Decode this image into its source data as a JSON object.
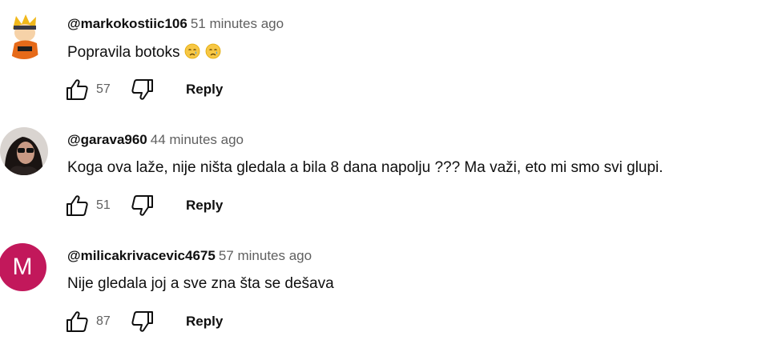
{
  "comments": [
    {
      "handle": "@markokostiic106",
      "time": "51 minutes ago",
      "text": "Popravila botoks",
      "emojis": [
        "crying-face",
        "crying-face"
      ],
      "likes": "57",
      "reply_label": "Reply"
    },
    {
      "handle": "@garava960",
      "time": "44 minutes ago",
      "text": "Koga ova laže, nije ništa gledala  a bila 8 dana napolju ??? Ma važi, eto mi smo svi glupi.",
      "likes": "51",
      "reply_label": "Reply"
    },
    {
      "handle": "@milicakrivacevic4675",
      "time": "57 minutes ago",
      "text": "Nije gledala joj a sve zna šta se dešava",
      "avatar_letter": "M",
      "avatar_color": "#c2185b",
      "likes": "87",
      "reply_label": "Reply"
    }
  ],
  "icons": {
    "like": "thumb-up-icon",
    "dislike": "thumb-down-icon"
  }
}
